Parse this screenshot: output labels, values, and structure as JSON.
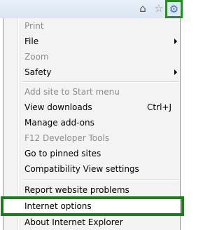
{
  "toolbar": {
    "icons": [
      "home-icon",
      "favorites-star-icon",
      "tools-gear-icon"
    ],
    "highlight_color": "#1e7b1e"
  },
  "menu": {
    "items": [
      {
        "label": "Print",
        "disabled": true,
        "submenu": false
      },
      {
        "label": "File",
        "disabled": false,
        "submenu": true
      },
      {
        "label": "Zoom",
        "disabled": true,
        "submenu": false
      },
      {
        "label": "Safety",
        "disabled": false,
        "submenu": true
      },
      {
        "label": "Add site to Start menu",
        "disabled": true,
        "submenu": false
      },
      {
        "label": "View downloads",
        "shortcut": "Ctrl+J",
        "disabled": false,
        "submenu": false
      },
      {
        "label": "Manage add-ons",
        "disabled": false,
        "submenu": false
      },
      {
        "label": "F12 Developer Tools",
        "disabled": true,
        "submenu": false
      },
      {
        "label": "Go to pinned sites",
        "disabled": false,
        "submenu": false
      },
      {
        "label": "Compatibility View settings",
        "disabled": false,
        "submenu": false
      },
      {
        "label": "Report website problems",
        "disabled": false,
        "submenu": false
      },
      {
        "label": "Internet options",
        "disabled": false,
        "submenu": false,
        "highlighted": true
      },
      {
        "label": "About Internet Explorer",
        "disabled": false,
        "submenu": false
      }
    ]
  }
}
